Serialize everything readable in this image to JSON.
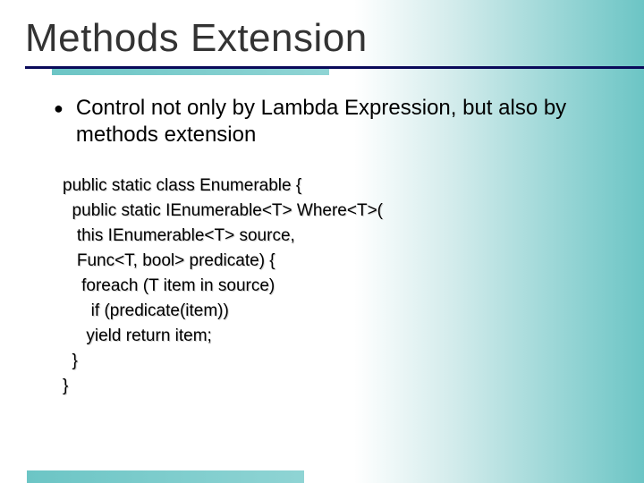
{
  "title": "Methods Extension",
  "bullet": "Control not only by Lambda Expression, but also by methods extension",
  "code": {
    "l0": "public static class Enumerable {",
    "l1": "  public static IEnumerable<T> Where<T>(",
    "l2": "   this IEnumerable<T> source,",
    "l3": "   Func<T, bool> predicate) {",
    "l4": "    foreach (T item in source)",
    "l5": "      if (predicate(item))",
    "l6": "     yield return item;",
    "l7": "  }",
    "l8": "}"
  }
}
